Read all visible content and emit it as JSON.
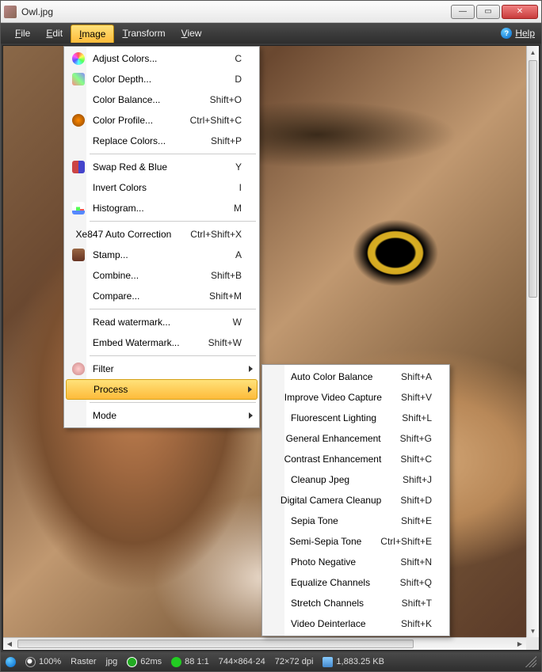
{
  "window": {
    "title": "Owl.jpg"
  },
  "menubar": {
    "items": [
      {
        "label": "File"
      },
      {
        "label": "Edit"
      },
      {
        "label": "Image"
      },
      {
        "label": "Transform"
      },
      {
        "label": "View"
      }
    ],
    "help": "Help"
  },
  "image_menu": {
    "items": [
      {
        "label": "Adjust Colors...",
        "shortcut": "C",
        "icon": "palette"
      },
      {
        "label": "Color Depth...",
        "shortcut": "D",
        "icon": "depth"
      },
      {
        "label": "Color Balance...",
        "shortcut": "Shift+O"
      },
      {
        "label": "Color Profile...",
        "shortcut": "Ctrl+Shift+C",
        "icon": "profile"
      },
      {
        "label": "Replace Colors...",
        "shortcut": "Shift+P"
      },
      {
        "sep": true
      },
      {
        "label": "Swap Red & Blue",
        "shortcut": "Y",
        "icon": "swap"
      },
      {
        "label": "Invert Colors",
        "shortcut": "I"
      },
      {
        "label": "Histogram...",
        "shortcut": "M",
        "icon": "hist"
      },
      {
        "sep": true
      },
      {
        "label": "Xe847 Auto Correction",
        "shortcut": "Ctrl+Shift+X"
      },
      {
        "label": "Stamp...",
        "shortcut": "A",
        "icon": "stamp"
      },
      {
        "label": "Combine...",
        "shortcut": "Shift+B"
      },
      {
        "label": "Compare...",
        "shortcut": "Shift+M"
      },
      {
        "sep": true
      },
      {
        "label": "Read watermark...",
        "shortcut": "W"
      },
      {
        "label": "Embed Watermark...",
        "shortcut": "Shift+W"
      },
      {
        "sep": true
      },
      {
        "label": "Filter",
        "submenu": true,
        "icon": "filter"
      },
      {
        "label": "Process",
        "submenu": true,
        "highlight": true
      },
      {
        "sep": true
      },
      {
        "label": "Mode",
        "submenu": true
      }
    ]
  },
  "process_menu": {
    "items": [
      {
        "label": "Auto Color Balance",
        "shortcut": "Shift+A"
      },
      {
        "label": "Improve Video Capture",
        "shortcut": "Shift+V"
      },
      {
        "label": "Fluorescent Lighting",
        "shortcut": "Shift+L"
      },
      {
        "label": "General Enhancement",
        "shortcut": "Shift+G"
      },
      {
        "label": "Contrast Enhancement",
        "shortcut": "Shift+C"
      },
      {
        "label": "Cleanup Jpeg",
        "shortcut": "Shift+J"
      },
      {
        "label": "Digital Camera Cleanup",
        "shortcut": "Shift+D"
      },
      {
        "label": "Sepia Tone",
        "shortcut": "Shift+E"
      },
      {
        "label": "Semi-Sepia Tone",
        "shortcut": "Ctrl+Shift+E"
      },
      {
        "label": "Photo Negative",
        "shortcut": "Shift+N"
      },
      {
        "label": "Equalize Channels",
        "shortcut": "Shift+Q"
      },
      {
        "label": "Stretch Channels",
        "shortcut": "Shift+T"
      },
      {
        "label": "Video Deinterlace",
        "shortcut": "Shift+K"
      }
    ]
  },
  "statusbar": {
    "zoom": "100%",
    "type": "Raster",
    "format": "jpg",
    "time": "62ms",
    "ratio": "88 1:1",
    "dims": "744×864·24",
    "dpi": "72×72 dpi",
    "memory": "1,883.25 KB"
  }
}
